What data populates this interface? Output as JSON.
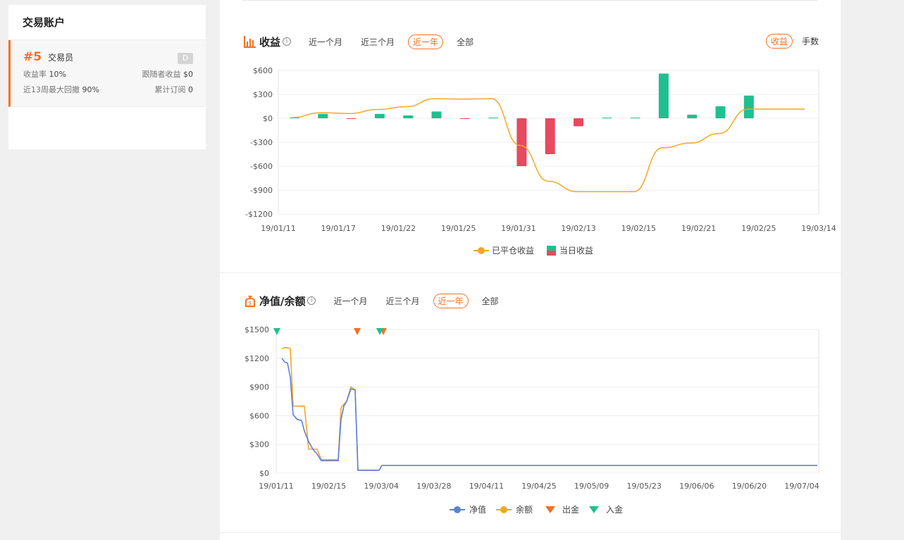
{
  "account": {
    "title": "交易账户",
    "trader": {
      "rank": "#5",
      "name": "交易员",
      "badge": "D",
      "return_label": "收益率",
      "return_value": "10%",
      "follower_profit_label": "跟随者收益",
      "follower_profit_value": "$0",
      "drawdown_label": "近13周最大回撤",
      "drawdown_value": "90%",
      "subs_label": "累计订阅",
      "subs_value": "0"
    }
  },
  "profit_section": {
    "title": "收益",
    "info": "i",
    "tabs": [
      "近一个月",
      "近三个月",
      "近一年",
      "全部"
    ],
    "active_tab": "近一年",
    "metric_tabs": [
      "收益",
      "手数"
    ],
    "active_metric": "收益"
  },
  "equity_section": {
    "title": "净值/余额",
    "info": "i",
    "tabs": [
      "近一个月",
      "近三个月",
      "近一年",
      "全部"
    ],
    "active_tab": "近一年"
  },
  "colors": {
    "accent": "#f47023",
    "closed_line": "#f5a623",
    "profit_up": "#1fbf8f",
    "profit_down": "#e84a5f",
    "equity_line": "#5b7fe0",
    "balance_line": "#f5a623",
    "withdraw": "#f47023",
    "deposit": "#1fbf8f"
  },
  "chart_data": [
    {
      "type": "bar",
      "title": "收益",
      "ylim": [
        -1200,
        600
      ],
      "y_ticks": [
        "$600",
        "$300",
        "$0",
        "-$300",
        "-$600",
        "-$900",
        "-$1200"
      ],
      "x_ticks": [
        "19/01/11",
        "19/01/17",
        "19/01/22",
        "19/01/25",
        "19/01/31",
        "19/02/13",
        "19/02/15",
        "19/02/21",
        "19/02/25",
        "19/03/14"
      ],
      "series": [
        {
          "name": "当日收益",
          "kind": "bar",
          "values": [
            10,
            55,
            -5,
            55,
            35,
            85,
            -5,
            8,
            -600,
            -450,
            -100,
            3,
            3,
            560,
            45,
            150,
            285
          ]
        },
        {
          "name": "已平仓收益",
          "kind": "line",
          "values": [
            10,
            70,
            60,
            110,
            145,
            245,
            240,
            245,
            -340,
            -790,
            -920,
            -920,
            -920,
            -370,
            -310,
            -190,
            115,
            115,
            115
          ]
        }
      ],
      "legend": [
        "已平仓收益",
        "当日收益"
      ],
      "legend_position": "bottom",
      "grid": true
    },
    {
      "type": "line",
      "title": "净值/余额",
      "ylim": [
        0,
        1500
      ],
      "y_ticks": [
        "$1500",
        "$1200",
        "$900",
        "$600",
        "$300",
        "$0"
      ],
      "x_ticks": [
        "19/01/11",
        "19/02/15",
        "19/03/04",
        "19/03/28",
        "19/04/11",
        "19/04/25",
        "19/05/09",
        "19/05/23",
        "19/06/06",
        "19/06/20",
        "19/07/04"
      ],
      "series": [
        {
          "name": "净值",
          "values": [
            1200,
            1160,
            1150,
            1000,
            610,
            560,
            550,
            440,
            330,
            250,
            200,
            130,
            130,
            130,
            560,
            700,
            750,
            880,
            870,
            30,
            30,
            30,
            30,
            80,
            80,
            80
          ]
        },
        {
          "name": "余额",
          "values": [
            1300,
            1310,
            1310,
            1300,
            700,
            700,
            700,
            700,
            250,
            250,
            250,
            140,
            140,
            140,
            680,
            720,
            750,
            900,
            870,
            30,
            30,
            30,
            30,
            80,
            80,
            80
          ]
        },
        {
          "name": "出金",
          "marker": "down-triangle",
          "events": [
            "19/02/22",
            "19/03/04"
          ]
        },
        {
          "name": "入金",
          "marker": "down-triangle",
          "events": [
            "19/01/11",
            "19/03/03"
          ]
        }
      ],
      "legend": [
        "净值",
        "余额",
        "出金",
        "入金"
      ],
      "legend_position": "bottom",
      "grid": true
    }
  ]
}
